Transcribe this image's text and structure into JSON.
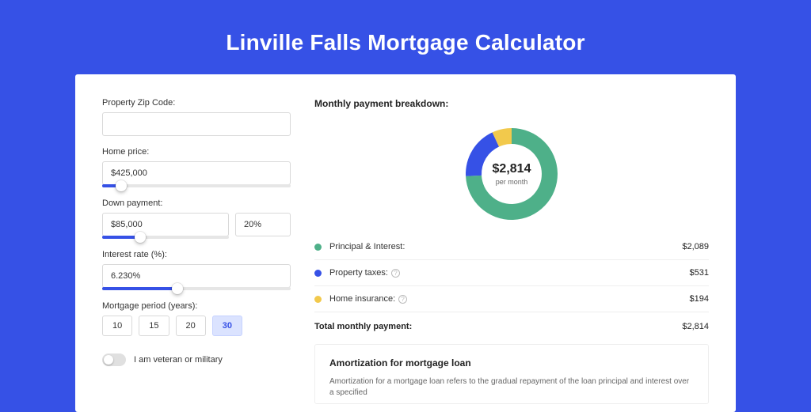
{
  "title": "Linville Falls Mortgage Calculator",
  "form": {
    "zip_label": "Property Zip Code:",
    "zip_value": "",
    "home_price_label": "Home price:",
    "home_price_value": "$425,000",
    "home_price_slider_pct": 10,
    "down_payment_label": "Down payment:",
    "down_payment_value": "$85,000",
    "down_payment_pct_value": "20%",
    "down_payment_slider_pct": 30,
    "interest_label": "Interest rate (%):",
    "interest_value": "6.230%",
    "interest_slider_pct": 40,
    "period_label": "Mortgage period (years):",
    "periods": [
      "10",
      "15",
      "20",
      "30"
    ],
    "period_active": "30",
    "veteran_label": "I am veteran or military"
  },
  "breakdown": {
    "title": "Monthly payment breakdown:",
    "center_value": "$2,814",
    "center_sub": "per month",
    "items": [
      {
        "label": "Principal & Interest:",
        "value": "$2,089",
        "color": "#4eb089",
        "has_info": false
      },
      {
        "label": "Property taxes:",
        "value": "$531",
        "color": "#3651e6",
        "has_info": true
      },
      {
        "label": "Home insurance:",
        "value": "$194",
        "color": "#f2c94c",
        "has_info": true
      }
    ],
    "total_label": "Total monthly payment:",
    "total_value": "$2,814"
  },
  "chart_data": {
    "type": "pie",
    "title": "Monthly payment breakdown",
    "series": [
      {
        "name": "Principal & Interest",
        "value": 2089,
        "color": "#4eb089"
      },
      {
        "name": "Property taxes",
        "value": 531,
        "color": "#3651e6"
      },
      {
        "name": "Home insurance",
        "value": 194,
        "color": "#f2c94c"
      }
    ],
    "total": 2814
  },
  "amortization": {
    "title": "Amortization for mortgage loan",
    "text": "Amortization for a mortgage loan refers to the gradual repayment of the loan principal and interest over a specified"
  }
}
